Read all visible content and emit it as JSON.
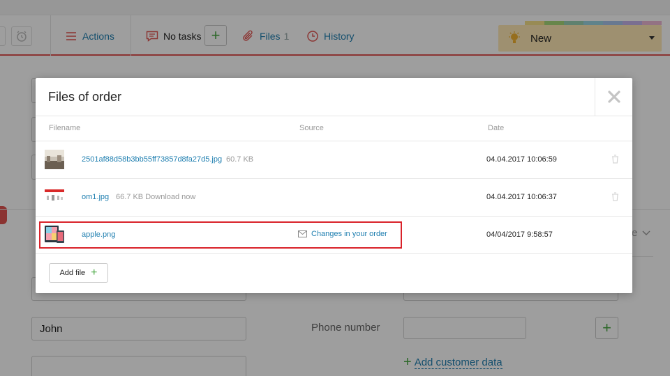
{
  "toolbar": {
    "actions_label": "Actions",
    "tasks_label": "No tasks",
    "files_label": "Files",
    "files_count": "1",
    "history_label": "History",
    "add_task_label": "+"
  },
  "status": {
    "label": "New",
    "colors": [
      "#f6e08a",
      "#a6d97a",
      "#9ad1b3",
      "#9cd4e0",
      "#a8c3ea",
      "#c6b4ea",
      "#eeb9d6"
    ]
  },
  "background_form": {
    "first_name_value": "John",
    "phone_label": "Phone number",
    "add_phone_label": "+",
    "add_customer_data_label": "Add customer data",
    "add_customer_data_icon": "+",
    "partial_label_fragment": "e"
  },
  "modal": {
    "title": "Files of order",
    "close_icon": "close-icon",
    "columns": {
      "filename": "Filename",
      "source": "Source",
      "date": "Date"
    },
    "files": [
      {
        "name": "2501af88d58b3bb55ff73857d8fa27d5.jpg",
        "size": "60.7 KB",
        "source": "",
        "date": "04.04.2017 10:06:59",
        "thumb": "photo-thumbnail"
      },
      {
        "name": "om1.jpg",
        "size": "66.7 KB Download now",
        "source": "",
        "date": "04.04.2017 10:06:37",
        "thumb": "webpage-thumbnail"
      },
      {
        "name": "apple.png",
        "size": "",
        "source": "Changes in your order",
        "date": "04/04/2017 9:58:57",
        "thumb": "devices-thumbnail"
      }
    ],
    "add_file_label": "Add file",
    "add_file_icon": "+"
  },
  "colors": {
    "accent_blue": "#1f7fb0",
    "accent_green": "#49a843",
    "topbar_border": "#e0534f",
    "highlight": "#d9222a",
    "status_bg": "#ffe9b5"
  }
}
